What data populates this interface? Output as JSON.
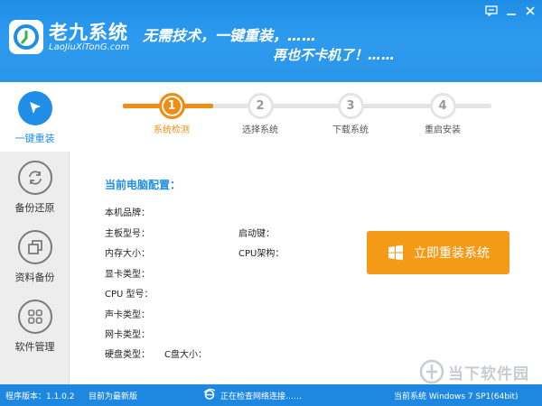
{
  "header": {
    "brand": "老九系统",
    "brand_sub": "LaoJiuXiTonG.com",
    "slogan_line1": "无需技术，一键重装，……",
    "slogan_line2": "再也不卡机了！……"
  },
  "sidebar": {
    "items": [
      {
        "label": "一键重装",
        "icon": "cursor-arrow-icon",
        "active": true
      },
      {
        "label": "备份还原",
        "icon": "refresh-icon",
        "active": false
      },
      {
        "label": "资料备份",
        "icon": "copy-icon",
        "active": false
      },
      {
        "label": "软件管理",
        "icon": "grid-icon",
        "active": false
      }
    ]
  },
  "steps": [
    {
      "num": "1",
      "label": "系统检测",
      "active": true
    },
    {
      "num": "2",
      "label": "选择系统",
      "active": false
    },
    {
      "num": "3",
      "label": "下载系统",
      "active": false
    },
    {
      "num": "4",
      "label": "重启安装",
      "active": false
    }
  ],
  "config": {
    "title": "当前电脑配置：",
    "brand_label": "本机品牌：",
    "board_label": "主板型号：",
    "boot_label": "启动键：",
    "memory_label": "内存大小：",
    "cpu_arch_label": "CPU架构：",
    "gpu_label": "显卡类型：",
    "cpu_label": "CPU 型号：",
    "sound_label": "声卡类型：",
    "nic_label": "网卡类型：",
    "disk_label": "硬盘类型：",
    "c_size_label": "C盘大小："
  },
  "reinstall_button": {
    "label": "立即重装系统",
    "icon": "windows-logo-icon"
  },
  "watermark": {
    "text": "当下软件园"
  },
  "status": {
    "version": "程序版本：1.1.0.2",
    "latest": "目前为最新版",
    "network": "正在检查网络连接……",
    "system": "当前系统 Windows 7 SP1(64bit)"
  },
  "colors": {
    "primary": "#1f8ee6",
    "accent": "#f08c11",
    "button": "#f59a17"
  }
}
